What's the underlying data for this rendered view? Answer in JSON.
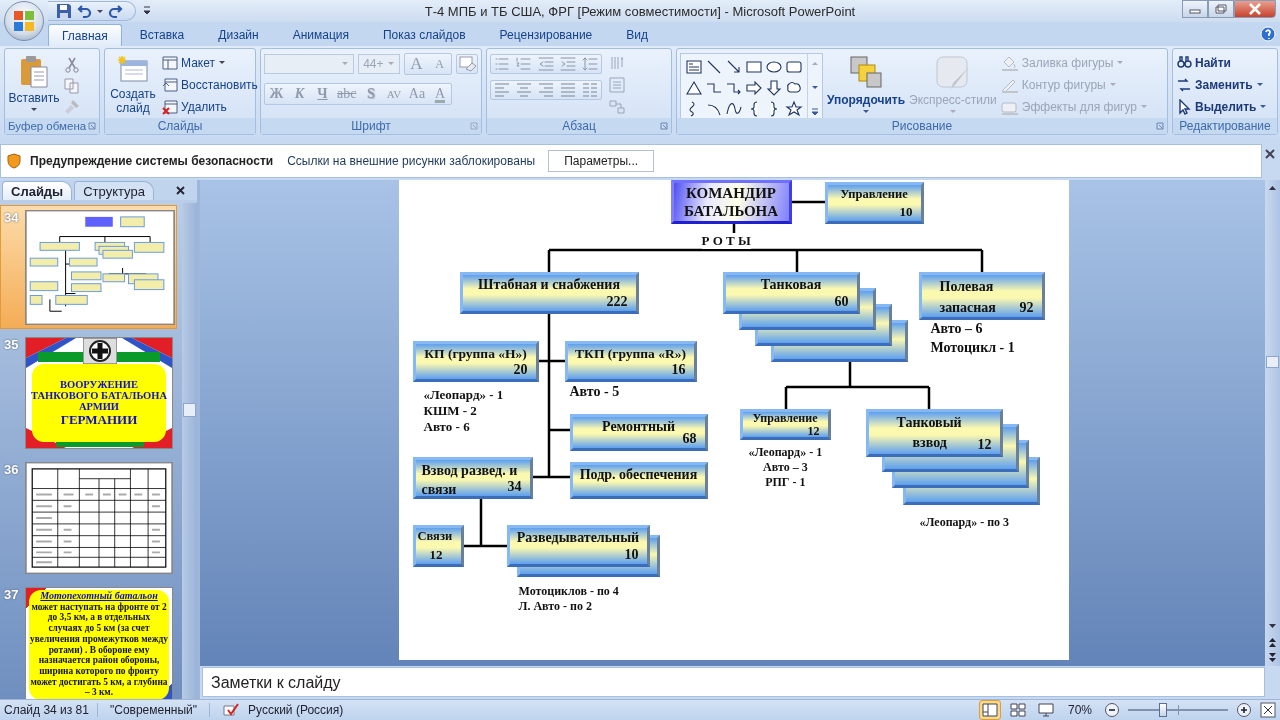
{
  "window": {
    "title": "Т-4 МПБ и ТБ США, ФРГ [Режим совместимости] - Microsoft PowerPoint"
  },
  "tabs": [
    {
      "label": "Главная",
      "selected": true
    },
    {
      "label": "Вставка",
      "selected": false
    },
    {
      "label": "Дизайн",
      "selected": false
    },
    {
      "label": "Анимация",
      "selected": false
    },
    {
      "label": "Показ слайдов",
      "selected": false
    },
    {
      "label": "Рецензирование",
      "selected": false
    },
    {
      "label": "Вид",
      "selected": false
    }
  ],
  "ribbon": {
    "clipboard": {
      "label": "Буфер обмена",
      "paste": "Вставить"
    },
    "slides": {
      "label": "Слайды",
      "new_slide": "Создать слайд",
      "items": [
        {
          "label": "Макет",
          "kind": "layout"
        },
        {
          "label": "Восстановить",
          "kind": "reset"
        },
        {
          "label": "Удалить",
          "kind": "delete"
        }
      ]
    },
    "font": {
      "label": "Шрифт",
      "size": "44+",
      "disabled": true,
      "size_buttons": [
        {
          "label": "A",
          "kind": "grow"
        },
        {
          "label": "A",
          "kind": "shrink"
        }
      ],
      "buttons": [
        {
          "label": "Ж",
          "kind": "bold"
        },
        {
          "label": "К",
          "kind": "italic"
        },
        {
          "label": "Ч",
          "kind": "underline"
        },
        {
          "label": "abc",
          "kind": "strike"
        },
        {
          "label": "S",
          "kind": "shadow"
        },
        {
          "label": "AV",
          "kind": "spacing"
        },
        {
          "label": "Aa",
          "kind": "case"
        },
        {
          "label": "A",
          "kind": "color"
        }
      ]
    },
    "paragraph": {
      "label": "Абзац"
    },
    "drawing": {
      "label": "Рисование",
      "arrange": "Упорядочить",
      "quick_styles": {
        "label": "Экспресс-стили",
        "disabled": true
      },
      "items": [
        {
          "label": "Заливка фигуры",
          "kind": "fill",
          "disabled": true
        },
        {
          "label": "Контур фигуры",
          "kind": "outline",
          "disabled": true
        },
        {
          "label": "Эффекты для фигур",
          "kind": "effects",
          "disabled": true
        }
      ]
    },
    "editing": {
      "label": "Редактирование",
      "items": [
        {
          "label": "Найти",
          "kind": "find"
        },
        {
          "label": "Заменить",
          "kind": "replace"
        },
        {
          "label": "Выделить",
          "kind": "select"
        }
      ]
    }
  },
  "security_bar": {
    "title": "Предупреждение системы безопасности",
    "message": "Ссылки на внешние рисунки заблокированы",
    "button": "Параметры..."
  },
  "slides_pane": {
    "tabs": [
      {
        "label": "Слайды",
        "selected": true
      },
      {
        "label": "Структура",
        "selected": false
      }
    ],
    "thumbnails": [
      {
        "number": "34",
        "kind": "chart",
        "selected": true
      },
      {
        "number": "35",
        "kind": "title",
        "selected": false,
        "lines": [
          "ВООРУЖЕНИЕ",
          "ТАНКОВОГО БАТАЛЬОНА",
          "АРМИИ",
          "ГЕРМАНИИ"
        ]
      },
      {
        "number": "36",
        "kind": "table",
        "selected": false
      },
      {
        "number": "37",
        "kind": "text",
        "selected": false,
        "heading": "Мотопехотный батальон",
        "body": "может наступать на фронте от 2 до 3,5 км,  а в отдельных случаях до 5 км (за счет увеличения промежутков между ротами) . В обороне ему назначается район обороны, ширина которого по фронту может достигать 5 км, а глубина – 3 км."
      }
    ]
  },
  "slide": {
    "caption": "Р О Т Ы",
    "nodes": [
      {
        "lines": [
          "КОМАНДИР",
          "БАТАЛЬОНА"
        ],
        "kind": "commander"
      },
      {
        "lines": [
          "Управление"
        ],
        "count": "10",
        "kind": "single"
      },
      {
        "lines": [
          "Штабная и снабжения"
        ],
        "count": "222",
        "kind": "single"
      },
      {
        "lines": [
          "Танковая"
        ],
        "count": "60",
        "kind": "quad"
      },
      {
        "lines": [
          "Полевая",
          "запасная"
        ],
        "count": "92",
        "kind": "single"
      },
      {
        "lines": [
          "КП (группа «Н»)"
        ],
        "count": "20",
        "kind": "single"
      },
      {
        "lines": [
          "ТКП (группа «R»)"
        ],
        "count": "16",
        "kind": "single"
      },
      {
        "lines": [
          "Ремонтный"
        ],
        "count": "68",
        "kind": "single"
      },
      {
        "lines": [
          "Взвод развед. и",
          "связи"
        ],
        "count": "34",
        "kind": "single"
      },
      {
        "lines": [
          "Подр. обеспечения"
        ],
        "kind": "single"
      },
      {
        "lines": [
          "Связи"
        ],
        "count": "12",
        "kind": "single"
      },
      {
        "lines": [
          "Разведывательный"
        ],
        "count": "10",
        "kind": "double"
      },
      {
        "lines": [
          "Управление"
        ],
        "count": "12",
        "kind": "single"
      },
      {
        "lines": [
          "Танковый",
          "взвод"
        ],
        "count": "12",
        "kind": "quad"
      }
    ],
    "notes": [
      {
        "lines": [
          "Авто – 6",
          "Мотоцикл - 1"
        ]
      },
      {
        "lines": [
          "«Леопард» - 1",
          "КШМ - 2",
          "Авто - 6"
        ]
      },
      {
        "lines": [
          "Авто - 5"
        ]
      },
      {
        "lines": [
          "«Леопард» - 1",
          "Авто – 3",
          "РПГ - 1"
        ]
      },
      {
        "lines": [
          "Мотоциклов - по 4",
          "Л. Авто - по 2"
        ]
      },
      {
        "lines": [
          "«Леопард» - по 3"
        ]
      }
    ]
  },
  "notes_pane": {
    "placeholder": "Заметки к слайду"
  },
  "status_bar": {
    "slide": "Слайд 34 из 81",
    "theme": "\"Современный\"",
    "language": "Русский (Россия)",
    "views": [
      {
        "kind": "normal",
        "selected": true
      },
      {
        "kind": "sorter",
        "selected": false
      },
      {
        "kind": "show",
        "selected": false
      }
    ],
    "zoom": {
      "label": "70%",
      "level": 0.35
    }
  }
}
